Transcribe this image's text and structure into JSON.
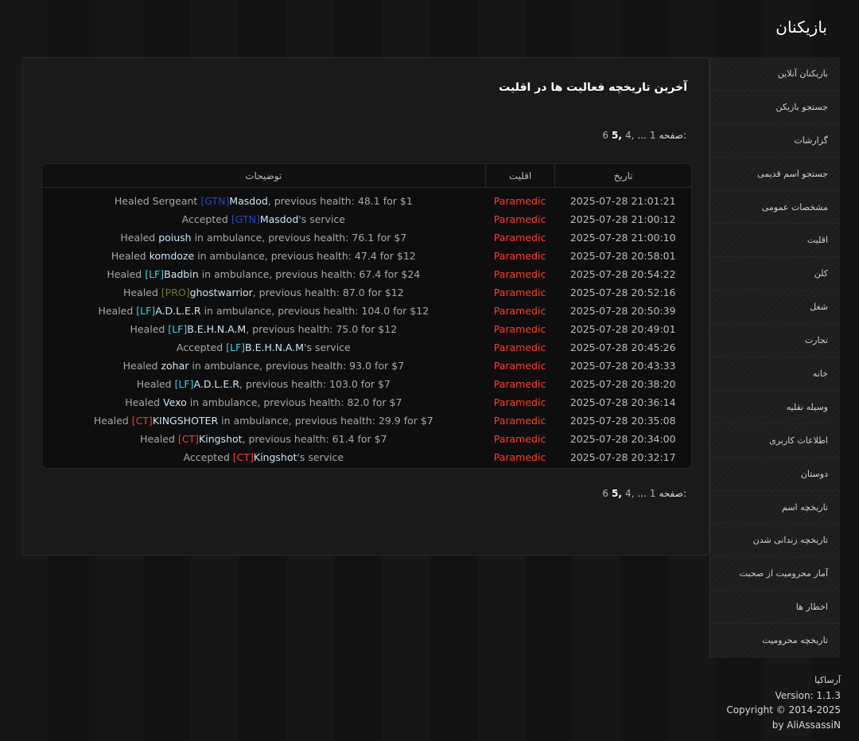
{
  "page": {
    "title": "بازیکنان"
  },
  "sidebar": {
    "items": [
      {
        "label": "بازیکنان آنلاین"
      },
      {
        "label": "جستجو بازیکن"
      },
      {
        "label": "گزارشات"
      },
      {
        "label": "جستجو اسم قدیمی"
      },
      {
        "label": "مشخصات عمومی"
      },
      {
        "label": "اقلیت"
      },
      {
        "label": "کلن"
      },
      {
        "label": "شغل"
      },
      {
        "label": "تجارت"
      },
      {
        "label": "خانه"
      },
      {
        "label": "وسیله نقلیه"
      },
      {
        "label": "اطلاعات کاربری"
      },
      {
        "label": "دوستان"
      },
      {
        "label": "تاریخچه اسم"
      },
      {
        "label": "تاریخچه زندانی شدن"
      },
      {
        "label": "آمار محرومیت از صحبت"
      },
      {
        "label": "اخطار ها"
      },
      {
        "label": "تاریخچه محرومیت"
      }
    ]
  },
  "panel": {
    "heading": "آخرین تاریخچه فعالیت ها در اقلیت",
    "pager": {
      "label": "صفحه:",
      "first": "1",
      "ellipsis": "...",
      "p4": "4,",
      "p5": "5,",
      "p6": "6"
    }
  },
  "table": {
    "headers": {
      "date": "تاریخ",
      "faction": "اقلیت",
      "description": "توضیحات"
    },
    "rows": [
      {
        "date": "2025-07-28 21:01:21",
        "faction": "Paramedic",
        "pre": "Healed Sergeant ",
        "tag": "[GTN]",
        "tag_color": "blue",
        "name": "Masdod",
        "post": ", previous health: 48.1 for $1"
      },
      {
        "date": "2025-07-28 21:00:12",
        "faction": "Paramedic",
        "pre": "Accepted ",
        "tag": "[GTN]",
        "tag_color": "blue",
        "name": "Masdod",
        "post": "'s service"
      },
      {
        "date": "2025-07-28 21:00:10",
        "faction": "Paramedic",
        "pre": "Healed ",
        "tag": "",
        "tag_color": "",
        "name": "poiush",
        "post": " in ambulance, previous health: 76.1 for $7"
      },
      {
        "date": "2025-07-28 20:58:01",
        "faction": "Paramedic",
        "pre": "Healed ",
        "tag": "",
        "tag_color": "",
        "name": "komdoze",
        "post": " in ambulance, previous health: 47.4 for $12"
      },
      {
        "date": "2025-07-28 20:54:22",
        "faction": "Paramedic",
        "pre": "Healed ",
        "tag": "[LF]",
        "tag_color": "cyan",
        "name": "Badbin",
        "post": " in ambulance, previous health: 67.4 for $24"
      },
      {
        "date": "2025-07-28 20:52:16",
        "faction": "Paramedic",
        "pre": "Healed ",
        "tag": "[PRO]",
        "tag_color": "green",
        "name": "ghostwarrior",
        "post": ", previous health: 87.0 for $12"
      },
      {
        "date": "2025-07-28 20:50:39",
        "faction": "Paramedic",
        "pre": "Healed ",
        "tag": "[LF]",
        "tag_color": "cyan",
        "name": "A.D.L.E.R",
        "post": " in ambulance, previous health: 104.0 for $12"
      },
      {
        "date": "2025-07-28 20:49:01",
        "faction": "Paramedic",
        "pre": "Healed ",
        "tag": "[LF]",
        "tag_color": "cyan",
        "name": "B.E.H.N.A.M",
        "post": ", previous health: 75.0 for $12"
      },
      {
        "date": "2025-07-28 20:45:26",
        "faction": "Paramedic",
        "pre": "Accepted ",
        "tag": "[LF]",
        "tag_color": "cyan",
        "name": "B.E.H.N.A.M",
        "post": "'s service"
      },
      {
        "date": "2025-07-28 20:43:33",
        "faction": "Paramedic",
        "pre": "Healed ",
        "tag": "",
        "tag_color": "",
        "name": "zohar",
        "post": " in ambulance, previous health: 93.0 for $7"
      },
      {
        "date": "2025-07-28 20:38:20",
        "faction": "Paramedic",
        "pre": "Healed ",
        "tag": "[LF]",
        "tag_color": "cyan",
        "name": "A.D.L.E.R",
        "post": ", previous health: 103.0 for $7"
      },
      {
        "date": "2025-07-28 20:36:14",
        "faction": "Paramedic",
        "pre": "Healed ",
        "tag": "",
        "tag_color": "",
        "name": "Vexo",
        "post": " in ambulance, previous health: 82.0 for $7"
      },
      {
        "date": "2025-07-28 20:35:08",
        "faction": "Paramedic",
        "pre": "Healed ",
        "tag": "[CT]",
        "tag_color": "red",
        "name": "KINGSHOTER",
        "post": " in ambulance, previous health: 29.9 for $7"
      },
      {
        "date": "2025-07-28 20:34:00",
        "faction": "Paramedic",
        "pre": "Healed ",
        "tag": "[CT]",
        "tag_color": "red",
        "name": "Kingshot",
        "post": ", previous health: 61.4 for $7"
      },
      {
        "date": "2025-07-28 20:32:17",
        "faction": "Paramedic",
        "pre": "Accepted ",
        "tag": "[CT]",
        "tag_color": "red",
        "name": "Kingshot",
        "post": "'s service"
      }
    ]
  },
  "footer": {
    "brand": "آرساکپا",
    "version": "Version: 1.1.3",
    "copyright": "Copyright © 2014-2025",
    "author": "by AliAssassiN"
  },
  "colors": {
    "faction": "#ff3b2f",
    "tag_blue": "#2747c9",
    "tag_cyan": "#3ed0e8",
    "tag_green": "#6a7d2c",
    "tag_red": "#ff3b2f"
  }
}
